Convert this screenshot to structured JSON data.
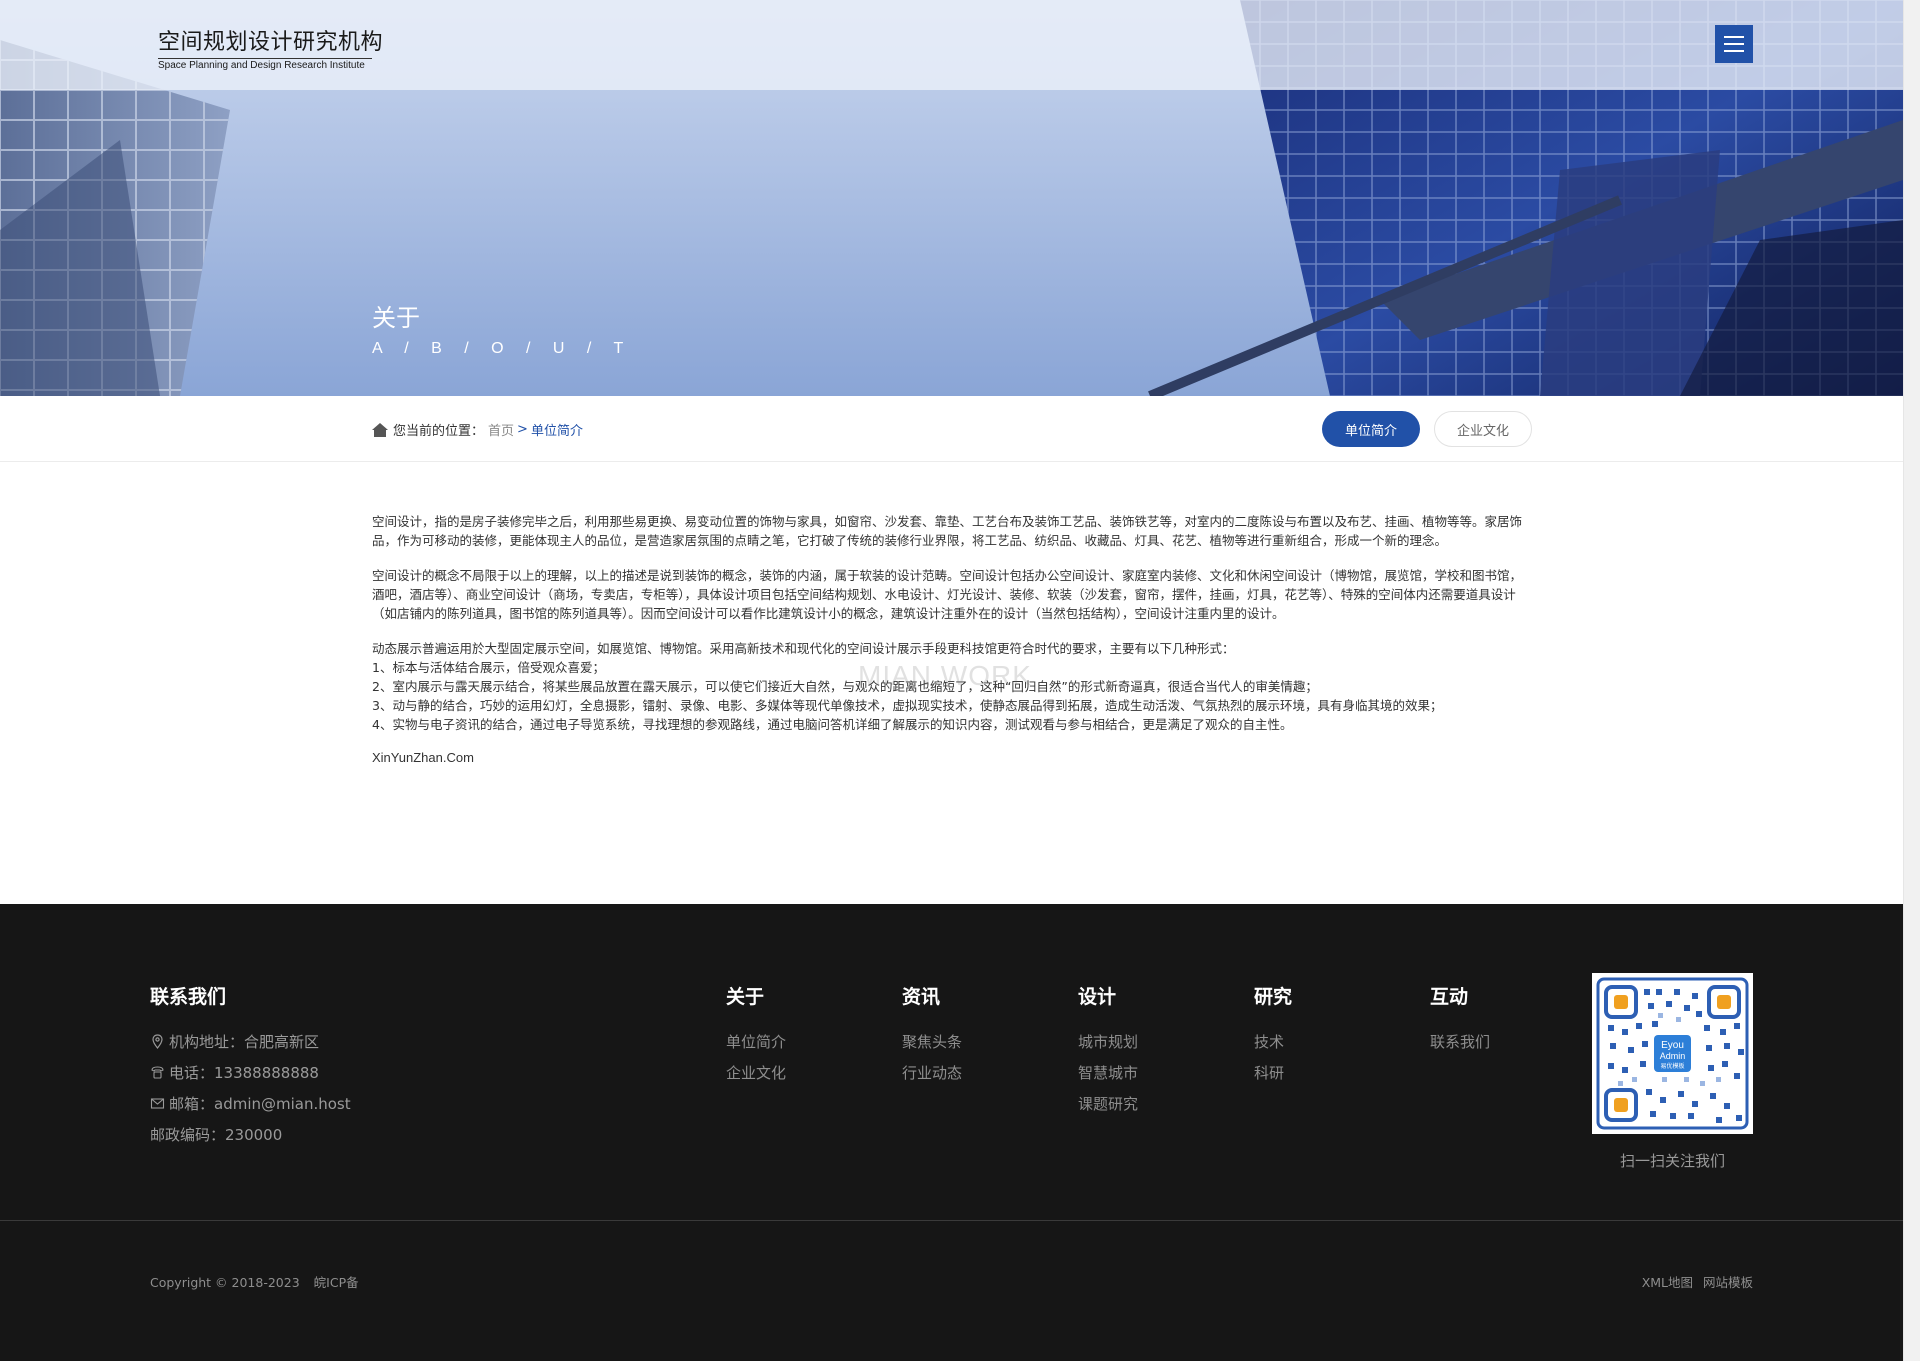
{
  "header": {
    "logo_cn": "空间规划设计研究机构",
    "logo_en": "Space Planning and Design Research Institute",
    "menu_icon": "menu-icon"
  },
  "banner": {
    "title": "关于",
    "subtitle": "A / B / O / U / T"
  },
  "breadcrumb": {
    "prefix": "您当前的位置：",
    "home": "首页",
    "separator": ">",
    "current": "单位简介",
    "icon": "home-icon"
  },
  "tabs": [
    {
      "label": "单位简介",
      "active": true
    },
    {
      "label": "企业文化",
      "active": false
    }
  ],
  "content": {
    "paragraphs": [
      "空间设计，指的是房子装修完毕之后，利用那些易更换、易变动位置的饰物与家具，如窗帘、沙发套、靠垫、工艺台布及装饰工艺品、装饰铁艺等，对室内的二度陈设与布置以及布艺、挂画、植物等等。家居饰品，作为可移动的装修，更能体现主人的品位，是营造家居氛围的点睛之笔，它打破了传统的装修行业界限，将工艺品、纺织品、收藏品、灯具、花艺、植物等进行重新组合，形成一个新的理念。",
      "空间设计的概念不局限于以上的理解，以上的描述是说到装饰的概念，装饰的内涵，属于软装的设计范畴。空间设计包括办公空间设计、家庭室内装修、文化和休闲空间设计（博物馆，展览馆，学校和图书馆，酒吧，酒店等）、商业空间设计（商场，专卖店，专柜等），具体设计项目包括空间结构规划、水电设计、灯光设计、装修、软装（沙发套，窗帘，摆件，挂画，灯具，花艺等）、特殊的空间体内还需要道具设计（如店铺内的陈列道具，图书馆的陈列道具等）。因而空间设计可以看作比建筑设计小的概念，建筑设计注重外在的设计（当然包括结构），空间设计注重内里的设计。"
    ],
    "list_intro": "动态展示普遍运用於大型固定展示空间，如展览馆、博物馆。采用高新技术和现代化的空间设计展示手段更科技馆更符合时代的要求，主要有以下几种形式：",
    "list_items": [
      "1、标本与活体结合展示，倍受观众喜爱；",
      "2、室内展示与露天展示结合，将某些展品放置在露天展示，可以使它们接近大自然，与观众的距离也缩短了，这种“回归自然”的形式新奇逼真，很适合当代人的审美情趣；",
      "3、动与静的结合，巧妙的运用幻灯，全息摄影，镭射、录像、电影、多媒体等现代单像技术，虚拟现实技术，使静态展品得到拓展，造成生动活泼、气氛热烈的展示环境，具有身临其境的效果；",
      "4、实物与电子资讯的结合，通过电子导览系统，寻找理想的参观路线，通过电脑问答机详细了解展示的知识内容，测试观看与参与相结合，更是满足了观众的自主性。"
    ],
    "site": "XinYunZhan.Com",
    "watermark": "MIAN.WORK"
  },
  "footer": {
    "contact": {
      "title": "联系我们",
      "address": "机构地址：合肥高新区",
      "phone": "电话：13388888888",
      "email": "邮箱：admin@mian.host",
      "postcode": "邮政编码：230000"
    },
    "columns": [
      {
        "title": "关于",
        "links": [
          "单位简介",
          "企业文化"
        ]
      },
      {
        "title": "资讯",
        "links": [
          "聚焦头条",
          "行业动态"
        ]
      },
      {
        "title": "设计",
        "links": [
          "城市规划",
          "智慧城市",
          "课题研究"
        ]
      },
      {
        "title": "研究",
        "links": [
          "技术",
          "科研"
        ]
      },
      {
        "title": "互动",
        "links": [
          "联系我们"
        ]
      }
    ],
    "qr_caption": "扫一扫关注我们",
    "qr_center_line1": "Eyou",
    "qr_center_line2": "Admin",
    "qr_center_line3": "易优模板",
    "copyright": "Copyright © 2018-2023",
    "icp": "皖ICP备",
    "bottom_links": [
      "XML地图",
      "网站模板"
    ]
  },
  "colors": {
    "accent": "#2151a8",
    "footer_bg": "#161616"
  }
}
